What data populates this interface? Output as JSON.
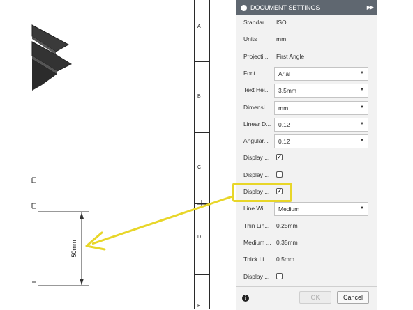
{
  "panel": {
    "title": "DOCUMENT SETTINGS",
    "rows": [
      {
        "label": "Standar...",
        "kind": "text",
        "value": "ISO"
      },
      {
        "label": "Units",
        "kind": "text",
        "value": "mm"
      },
      {
        "label": "Projecti...",
        "kind": "text",
        "value": "First Angle"
      },
      {
        "label": "Font",
        "kind": "dropdown",
        "value": "Arial"
      },
      {
        "label": "Text Hei...",
        "kind": "dropdown",
        "value": "3.5mm"
      },
      {
        "label": "Dimensi...",
        "kind": "dropdown",
        "value": "mm"
      },
      {
        "label": "Linear D...",
        "kind": "dropdown",
        "value": "0.12"
      },
      {
        "label": "Angular...",
        "kind": "dropdown",
        "value": "0.12"
      },
      {
        "label": "Display ...",
        "kind": "checkbox",
        "checked": true
      },
      {
        "label": "Display ...",
        "kind": "checkbox",
        "checked": false
      },
      {
        "label": "Display ...",
        "kind": "checkbox",
        "checked": true
      },
      {
        "label": "Line Wi...",
        "kind": "dropdown",
        "value": "Medium"
      },
      {
        "label": "Thin Lin...",
        "kind": "text",
        "value": "0.25mm"
      },
      {
        "label": "Medium ...",
        "kind": "text",
        "value": "0.35mm"
      },
      {
        "label": "Thick Li...",
        "kind": "text",
        "value": "0.5mm"
      },
      {
        "label": "Display ...",
        "kind": "checkbox",
        "checked": false
      }
    ],
    "ok_label": "OK",
    "cancel_label": "Cancel"
  },
  "drawing": {
    "zones": [
      "A",
      "B",
      "C",
      "D",
      "E"
    ],
    "dimension_text": "50mm"
  },
  "colors": {
    "highlight": "#e8d629",
    "header": "#5f6770"
  },
  "icons": {
    "collapse": "collapse-icon",
    "expand": "double-chevron-right-icon",
    "dropdown": "caret-down-icon",
    "info": "info-icon",
    "check": "checkmark-icon"
  }
}
